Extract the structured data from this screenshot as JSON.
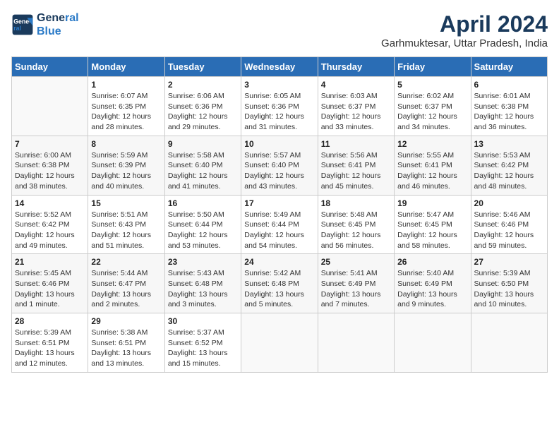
{
  "app": {
    "logo_line1": "General",
    "logo_line2": "Blue",
    "title": "April 2024",
    "subtitle": "Garhmuktesar, Uttar Pradesh, India"
  },
  "calendar": {
    "headers": [
      "Sunday",
      "Monday",
      "Tuesday",
      "Wednesday",
      "Thursday",
      "Friday",
      "Saturday"
    ],
    "weeks": [
      [
        {
          "day": "",
          "info": ""
        },
        {
          "day": "1",
          "info": "Sunrise: 6:07 AM\nSunset: 6:35 PM\nDaylight: 12 hours\nand 28 minutes."
        },
        {
          "day": "2",
          "info": "Sunrise: 6:06 AM\nSunset: 6:36 PM\nDaylight: 12 hours\nand 29 minutes."
        },
        {
          "day": "3",
          "info": "Sunrise: 6:05 AM\nSunset: 6:36 PM\nDaylight: 12 hours\nand 31 minutes."
        },
        {
          "day": "4",
          "info": "Sunrise: 6:03 AM\nSunset: 6:37 PM\nDaylight: 12 hours\nand 33 minutes."
        },
        {
          "day": "5",
          "info": "Sunrise: 6:02 AM\nSunset: 6:37 PM\nDaylight: 12 hours\nand 34 minutes."
        },
        {
          "day": "6",
          "info": "Sunrise: 6:01 AM\nSunset: 6:38 PM\nDaylight: 12 hours\nand 36 minutes."
        }
      ],
      [
        {
          "day": "7",
          "info": "Sunrise: 6:00 AM\nSunset: 6:38 PM\nDaylight: 12 hours\nand 38 minutes."
        },
        {
          "day": "8",
          "info": "Sunrise: 5:59 AM\nSunset: 6:39 PM\nDaylight: 12 hours\nand 40 minutes."
        },
        {
          "day": "9",
          "info": "Sunrise: 5:58 AM\nSunset: 6:40 PM\nDaylight: 12 hours\nand 41 minutes."
        },
        {
          "day": "10",
          "info": "Sunrise: 5:57 AM\nSunset: 6:40 PM\nDaylight: 12 hours\nand 43 minutes."
        },
        {
          "day": "11",
          "info": "Sunrise: 5:56 AM\nSunset: 6:41 PM\nDaylight: 12 hours\nand 45 minutes."
        },
        {
          "day": "12",
          "info": "Sunrise: 5:55 AM\nSunset: 6:41 PM\nDaylight: 12 hours\nand 46 minutes."
        },
        {
          "day": "13",
          "info": "Sunrise: 5:53 AM\nSunset: 6:42 PM\nDaylight: 12 hours\nand 48 minutes."
        }
      ],
      [
        {
          "day": "14",
          "info": "Sunrise: 5:52 AM\nSunset: 6:42 PM\nDaylight: 12 hours\nand 49 minutes."
        },
        {
          "day": "15",
          "info": "Sunrise: 5:51 AM\nSunset: 6:43 PM\nDaylight: 12 hours\nand 51 minutes."
        },
        {
          "day": "16",
          "info": "Sunrise: 5:50 AM\nSunset: 6:44 PM\nDaylight: 12 hours\nand 53 minutes."
        },
        {
          "day": "17",
          "info": "Sunrise: 5:49 AM\nSunset: 6:44 PM\nDaylight: 12 hours\nand 54 minutes."
        },
        {
          "day": "18",
          "info": "Sunrise: 5:48 AM\nSunset: 6:45 PM\nDaylight: 12 hours\nand 56 minutes."
        },
        {
          "day": "19",
          "info": "Sunrise: 5:47 AM\nSunset: 6:45 PM\nDaylight: 12 hours\nand 58 minutes."
        },
        {
          "day": "20",
          "info": "Sunrise: 5:46 AM\nSunset: 6:46 PM\nDaylight: 12 hours\nand 59 minutes."
        }
      ],
      [
        {
          "day": "21",
          "info": "Sunrise: 5:45 AM\nSunset: 6:46 PM\nDaylight: 13 hours\nand 1 minute."
        },
        {
          "day": "22",
          "info": "Sunrise: 5:44 AM\nSunset: 6:47 PM\nDaylight: 13 hours\nand 2 minutes."
        },
        {
          "day": "23",
          "info": "Sunrise: 5:43 AM\nSunset: 6:48 PM\nDaylight: 13 hours\nand 3 minutes."
        },
        {
          "day": "24",
          "info": "Sunrise: 5:42 AM\nSunset: 6:48 PM\nDaylight: 13 hours\nand 5 minutes."
        },
        {
          "day": "25",
          "info": "Sunrise: 5:41 AM\nSunset: 6:49 PM\nDaylight: 13 hours\nand 7 minutes."
        },
        {
          "day": "26",
          "info": "Sunrise: 5:40 AM\nSunset: 6:49 PM\nDaylight: 13 hours\nand 9 minutes."
        },
        {
          "day": "27",
          "info": "Sunrise: 5:39 AM\nSunset: 6:50 PM\nDaylight: 13 hours\nand 10 minutes."
        }
      ],
      [
        {
          "day": "28",
          "info": "Sunrise: 5:39 AM\nSunset: 6:51 PM\nDaylight: 13 hours\nand 12 minutes."
        },
        {
          "day": "29",
          "info": "Sunrise: 5:38 AM\nSunset: 6:51 PM\nDaylight: 13 hours\nand 13 minutes."
        },
        {
          "day": "30",
          "info": "Sunrise: 5:37 AM\nSunset: 6:52 PM\nDaylight: 13 hours\nand 15 minutes."
        },
        {
          "day": "",
          "info": ""
        },
        {
          "day": "",
          "info": ""
        },
        {
          "day": "",
          "info": ""
        },
        {
          "day": "",
          "info": ""
        }
      ]
    ]
  }
}
